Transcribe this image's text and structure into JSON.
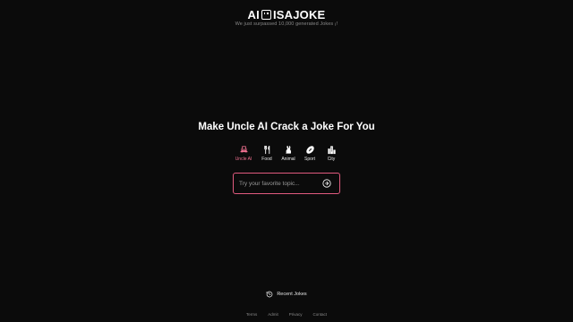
{
  "header": {
    "logo_left": "AI",
    "logo_right": "ISAJOKE",
    "tagline": "We just surpassed 10,000 generated Jokes ¡!"
  },
  "main": {
    "headline": "Make Uncle AI Crack a Joke For You",
    "categories": [
      {
        "label": "Uncle AI",
        "icon": "mustache-icon",
        "active": true
      },
      {
        "label": "Food",
        "icon": "utensils-icon",
        "active": false
      },
      {
        "label": "Animal",
        "icon": "rabbit-icon",
        "active": false
      },
      {
        "label": "Sport",
        "icon": "football-icon",
        "active": false
      },
      {
        "label": "City",
        "icon": "city-icon",
        "active": false
      }
    ],
    "search": {
      "placeholder": "Try your favorite topic...",
      "value": "",
      "submit_icon": "arrow-right-circle-icon"
    }
  },
  "recent": {
    "label": "Recent Jokes",
    "icon": "history-icon"
  },
  "footer": {
    "links": [
      "Terms",
      "Admit",
      "Privacy",
      "Contact"
    ]
  },
  "colors": {
    "background": "#0b0b0b",
    "accent": "#e05a7e",
    "active_label": "#f07090",
    "muted_text": "#8a8a8a"
  }
}
